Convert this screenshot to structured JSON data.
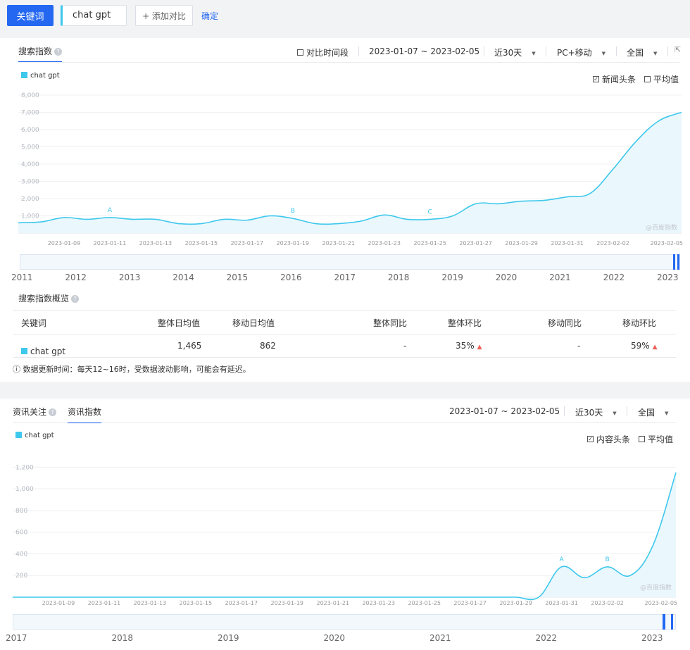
{
  "toolbar": {
    "keyword_button": "关键词",
    "keyword_input": "chat gpt",
    "add_compare": "+ 添加对比",
    "confirm": "确定"
  },
  "search_index": {
    "tab": "搜索指数",
    "compare_period": "对比时间段",
    "date_range": "2023-01-07 ~ 2023-02-05",
    "period": "近30天",
    "device": "PC+移动",
    "region": "全国",
    "legend": "chat gpt",
    "news_headlines": "新闻头条",
    "average": "平均值",
    "watermark": "@百度指数",
    "timeline_years": [
      "2011",
      "2012",
      "2013",
      "2014",
      "2015",
      "2016",
      "2017",
      "2018",
      "2019",
      "2020",
      "2021",
      "2022",
      "2023"
    ]
  },
  "overview": {
    "title": "搜索指数概览",
    "headers": [
      "关键词",
      "整体日均值",
      "移动日均值",
      "整体同比",
      "整体环比",
      "移动同比",
      "移动环比"
    ],
    "row": {
      "keyword": "chat gpt",
      "overall_avg": "1,465",
      "mobile_avg": "862",
      "overall_yoy": "-",
      "overall_mom": "35%",
      "mobile_yoy": "-",
      "mobile_mom": "59%"
    },
    "note": "数据更新时间：每天12~16时，受数据波动影响，可能会有延迟。"
  },
  "news_index": {
    "tab_attention": "资讯关注",
    "tab_index": "资讯指数",
    "date_range": "2023-01-07 ~ 2023-02-05",
    "period": "近30天",
    "region": "全国",
    "legend": "chat gpt",
    "content_headlines": "内容头条",
    "average": "平均值",
    "watermark": "@百度指数",
    "timeline_years": [
      "2017",
      "2018",
      "2019",
      "2020",
      "2021",
      "2022",
      "2023"
    ]
  },
  "chart_data": [
    {
      "type": "area",
      "title": "搜索指数",
      "series_name": "chat gpt",
      "x": [
        "2023-01-07",
        "2023-01-08",
        "2023-01-09",
        "2023-01-10",
        "2023-01-11",
        "2023-01-12",
        "2023-01-13",
        "2023-01-14",
        "2023-01-15",
        "2023-01-16",
        "2023-01-17",
        "2023-01-18",
        "2023-01-19",
        "2023-01-20",
        "2023-01-21",
        "2023-01-22",
        "2023-01-23",
        "2023-01-24",
        "2023-01-25",
        "2023-01-26",
        "2023-01-27",
        "2023-01-28",
        "2023-01-29",
        "2023-01-30",
        "2023-01-31",
        "2023-02-01",
        "2023-02-02",
        "2023-02-03",
        "2023-02-04",
        "2023-02-05"
      ],
      "xticks": [
        "2023-01-09",
        "2023-01-11",
        "2023-01-13",
        "2023-01-15",
        "2023-01-17",
        "2023-01-19",
        "2023-01-21",
        "2023-01-23",
        "2023-01-25",
        "2023-01-27",
        "2023-01-29",
        "2023-01-31",
        "2023-02-02",
        "2023-02-05"
      ],
      "values": [
        600,
        650,
        900,
        800,
        900,
        800,
        800,
        550,
        550,
        800,
        750,
        1000,
        850,
        550,
        550,
        700,
        1050,
        800,
        800,
        1000,
        1700,
        1700,
        1850,
        1900,
        2100,
        2300,
        3700,
        5300,
        6500,
        7000
      ],
      "yticks": [
        1000,
        2000,
        3000,
        4000,
        5000,
        6000,
        7000,
        8000
      ],
      "ylim": [
        0,
        8000
      ],
      "markers": [
        {
          "label": "A",
          "x": "2023-01-11"
        },
        {
          "label": "B",
          "x": "2023-01-19"
        },
        {
          "label": "C",
          "x": "2023-01-25"
        }
      ]
    },
    {
      "type": "area",
      "title": "资讯指数",
      "series_name": "chat gpt",
      "x": [
        "2023-01-07",
        "2023-01-08",
        "2023-01-09",
        "2023-01-10",
        "2023-01-11",
        "2023-01-12",
        "2023-01-13",
        "2023-01-14",
        "2023-01-15",
        "2023-01-16",
        "2023-01-17",
        "2023-01-18",
        "2023-01-19",
        "2023-01-20",
        "2023-01-21",
        "2023-01-22",
        "2023-01-23",
        "2023-01-24",
        "2023-01-25",
        "2023-01-26",
        "2023-01-27",
        "2023-01-28",
        "2023-01-29",
        "2023-01-30",
        "2023-01-31",
        "2023-02-01",
        "2023-02-02",
        "2023-02-03",
        "2023-02-04",
        "2023-02-05"
      ],
      "xticks": [
        "2023-01-09",
        "2023-01-11",
        "2023-01-13",
        "2023-01-15",
        "2023-01-17",
        "2023-01-19",
        "2023-01-21",
        "2023-01-23",
        "2023-01-25",
        "2023-01-27",
        "2023-01-29",
        "2023-01-31",
        "2023-02-02",
        "2023-02-05"
      ],
      "values": [
        0,
        0,
        0,
        0,
        0,
        0,
        0,
        0,
        0,
        0,
        0,
        0,
        0,
        0,
        0,
        0,
        0,
        0,
        0,
        0,
        0,
        0,
        0,
        0,
        280,
        180,
        280,
        200,
        480,
        1150
      ],
      "yticks": [
        200,
        400,
        600,
        800,
        1000,
        1200
      ],
      "ylim": [
        0,
        1300
      ],
      "markers": [
        {
          "label": "A",
          "x": "2023-01-31"
        },
        {
          "label": "B",
          "x": "2023-02-02"
        }
      ]
    }
  ]
}
